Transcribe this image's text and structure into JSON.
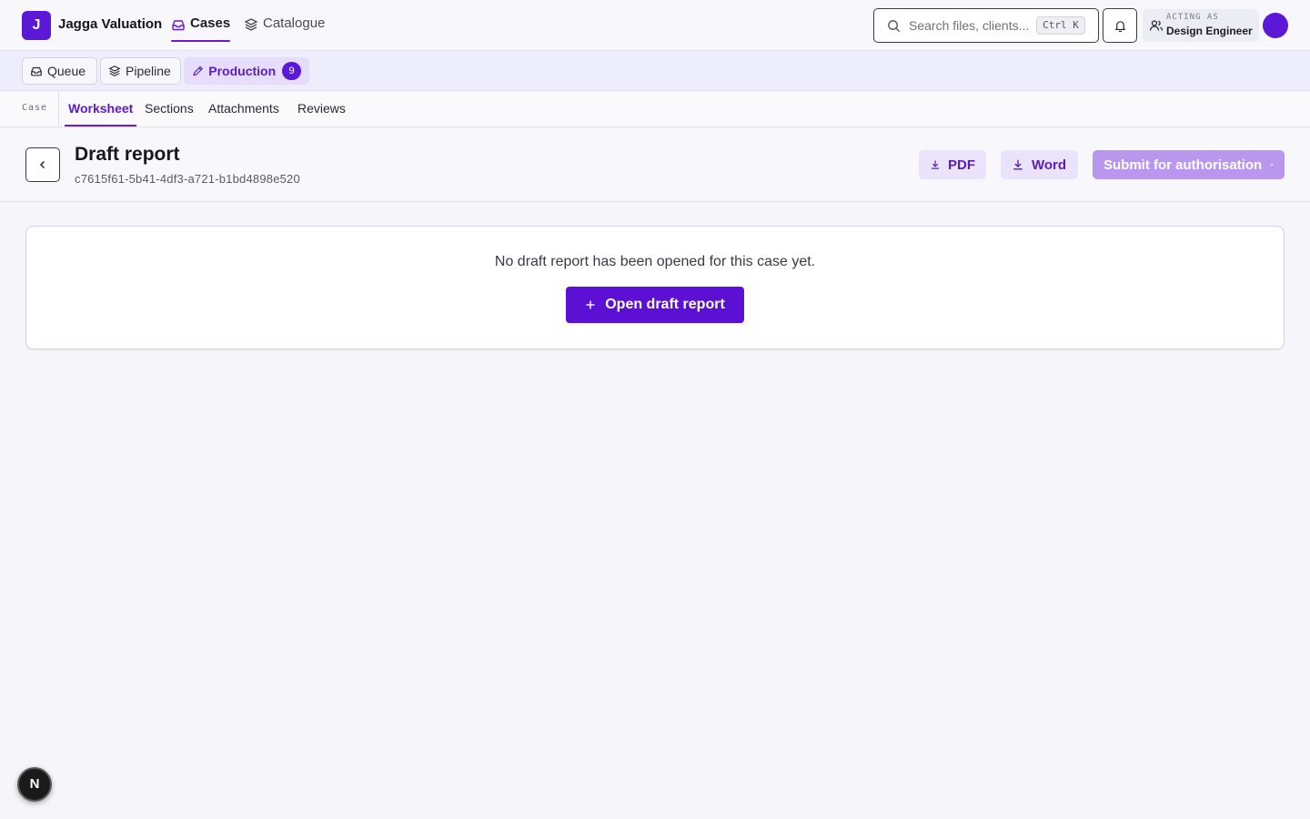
{
  "app": {
    "logo_letter": "J",
    "name": "Jagga Valuation"
  },
  "topnav": {
    "items": [
      {
        "label": "Cases",
        "icon": "inbox-icon",
        "active": true
      },
      {
        "label": "Catalogue",
        "icon": "layers-icon",
        "active": false
      }
    ]
  },
  "search": {
    "placeholder": "Search files, clients...",
    "shortcut": "Ctrl K"
  },
  "user": {
    "acting_label": "ACTING AS",
    "acting_name": "Design Engineer"
  },
  "subnav": {
    "items": [
      {
        "label": "Queue",
        "icon": "inbox-icon"
      },
      {
        "label": "Pipeline",
        "icon": "layers-icon"
      },
      {
        "label": "Production",
        "icon": "pencil-icon",
        "count": "9",
        "active": true
      }
    ]
  },
  "tabs": {
    "section_label": "Case",
    "items": [
      {
        "label": "Worksheet",
        "active": true
      },
      {
        "label": "Sections",
        "active": false
      },
      {
        "label": "Attachments",
        "active": false
      },
      {
        "label": "Reviews",
        "active": false
      }
    ]
  },
  "header": {
    "title": "Draft report",
    "id": "c7615f61-5b41-4df3-a721-b1bd4898e520",
    "actions": {
      "pdf": "PDF",
      "word": "Word",
      "submit": "Submit for authorisation"
    }
  },
  "empty_state": {
    "message": "No draft report has been opened for this case yet.",
    "button": "Open draft report"
  },
  "dev_badge": "N",
  "colors": {
    "brand": "#5b18d6",
    "brand_soft": "#ebe3fb",
    "submit_disabled": "#b997ee"
  }
}
